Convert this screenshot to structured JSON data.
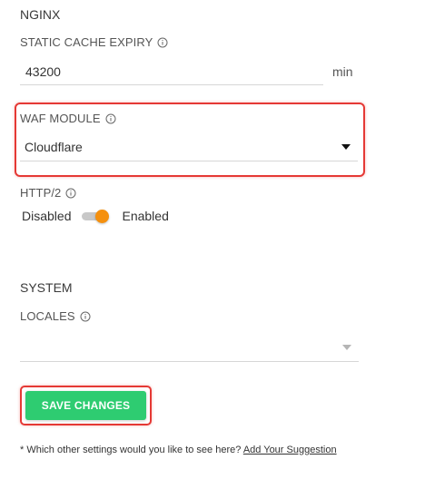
{
  "nginx": {
    "title": "NGINX",
    "static_cache_expiry": {
      "label": "STATIC CACHE EXPIRY",
      "value": "43200",
      "unit": "min"
    },
    "waf_module": {
      "label": "WAF MODULE",
      "selected": "Cloudflare"
    },
    "http2": {
      "label": "HTTP/2",
      "off_label": "Disabled",
      "on_label": "Enabled",
      "enabled": true,
      "knob_color": "#f5900e"
    }
  },
  "system": {
    "title": "SYSTEM",
    "locales": {
      "label": "LOCALES",
      "selected": ""
    }
  },
  "actions": {
    "save_label": "SAVE CHANGES",
    "save_color": "#2ecc71",
    "highlight_color": "#e53935"
  },
  "footer": {
    "prompt": "* Which other settings would you like to see here?",
    "link_label": "Add Your Suggestion"
  },
  "icons": {
    "info": "info-circle-icon",
    "dropdown": "caret-down-icon"
  }
}
